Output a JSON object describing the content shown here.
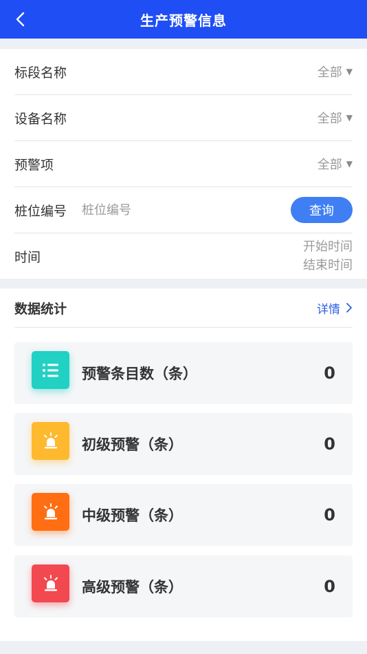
{
  "header": {
    "title": "生产预警信息"
  },
  "filters": {
    "section_label": {
      "label": "标段名称",
      "value": "全部"
    },
    "device_name": {
      "label": "设备名称",
      "value": "全部"
    },
    "warning_item": {
      "label": "预警项",
      "value": "全部"
    },
    "pile_number": {
      "label": "桩位编号",
      "placeholder": "桩位编号",
      "button": "查询"
    },
    "time": {
      "label": "时间",
      "start": "开始时间",
      "end": "结束时间"
    }
  },
  "stats": {
    "title": "数据统计",
    "detail": "详情",
    "items": [
      {
        "label": "预警条目数（条）",
        "value": "0",
        "icon": "list-icon",
        "color": "#21d1c4"
      },
      {
        "label": "初级预警（条）",
        "value": "0",
        "icon": "alarm-light-icon",
        "color": "#ffb92e"
      },
      {
        "label": "中级预警（条）",
        "value": "0",
        "icon": "alarm-light-icon",
        "color": "#ff6e12"
      },
      {
        "label": "高级预警（条）",
        "value": "0",
        "icon": "alarm-light-icon",
        "color": "#f2484f"
      }
    ]
  }
}
